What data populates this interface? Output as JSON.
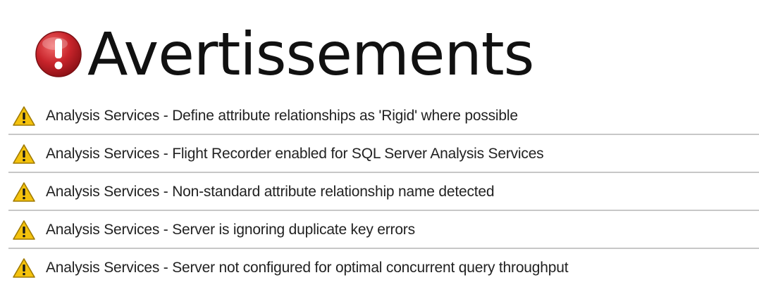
{
  "header": {
    "icon": "error-icon",
    "title": "Avertissements",
    "icon_color": "#c8242b"
  },
  "warnings": {
    "icon": "warning-icon",
    "icon_color": "#f4c20d",
    "items": [
      {
        "text": "Analysis Services - Define attribute relationships as 'Rigid' where possible"
      },
      {
        "text": "Analysis Services - Flight Recorder enabled for SQL Server Analysis Services"
      },
      {
        "text": "Analysis Services - Non-standard attribute relationship name detected"
      },
      {
        "text": "Analysis Services - Server is ignoring duplicate key errors"
      },
      {
        "text": "Analysis Services - Server not configured for optimal concurrent query throughput"
      }
    ]
  }
}
